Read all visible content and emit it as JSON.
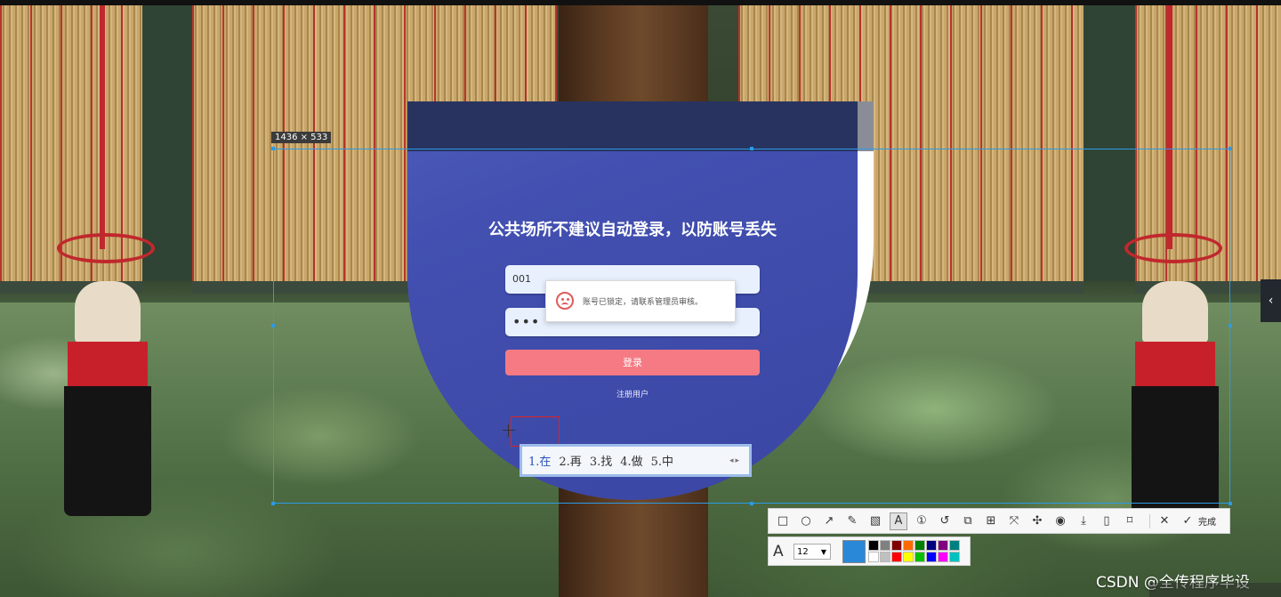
{
  "selection": {
    "size_label": "1436 × 533"
  },
  "login": {
    "title": "公共场所不建议自动登录，以防账号丢失",
    "username_value": "001",
    "password_value": "•••",
    "login_button": "登录",
    "register_link": "注册用户",
    "alert_message": "账号已锁定，请联系管理员审核。"
  },
  "ime": {
    "candidates": [
      "1.在",
      "2.再",
      "3.找",
      "4.做",
      "5.中"
    ],
    "page_arrows": "◂▸"
  },
  "side_tab": {
    "icon": "chevron-left-icon",
    "glyph": "‹"
  },
  "toolbar": {
    "tools": [
      {
        "name": "rectangle-icon",
        "glyph": "□"
      },
      {
        "name": "ellipse-icon",
        "glyph": "○"
      },
      {
        "name": "arrow-icon",
        "glyph": "↗"
      },
      {
        "name": "pencil-icon",
        "glyph": "✎"
      },
      {
        "name": "mosaic-icon",
        "glyph": "▧"
      },
      {
        "name": "text-icon",
        "glyph": "A"
      },
      {
        "name": "number-marker-icon",
        "glyph": "①"
      },
      {
        "name": "undo-icon",
        "glyph": "↺"
      },
      {
        "name": "ocr-icon",
        "glyph": "⧉"
      },
      {
        "name": "translate-icon",
        "glyph": "⊞"
      },
      {
        "name": "scroll-capture-icon",
        "glyph": "⤧"
      },
      {
        "name": "pin-icon",
        "glyph": "✣"
      },
      {
        "name": "record-icon",
        "glyph": "◉"
      },
      {
        "name": "download-icon",
        "glyph": "⤓"
      },
      {
        "name": "phone-icon",
        "glyph": "▯"
      },
      {
        "name": "bookmark-icon",
        "glyph": "⌑"
      }
    ],
    "close_glyph": "✕",
    "done_glyph": "✓",
    "done_label": "完成",
    "font_icon_glyph": "A",
    "font_size": "12",
    "dropdown_glyph": "▼",
    "current_color": "#2a88d8",
    "palette": [
      "#000000",
      "#808080",
      "#800000",
      "#ff6a00",
      "#008000",
      "#000080",
      "#800080",
      "#008080",
      "#ffffff",
      "#c0c0c0",
      "#ff0000",
      "#ffff00",
      "#00c000",
      "#0000ff",
      "#ff00ff",
      "#00c0c0"
    ]
  },
  "watermark": "CSDN @全传程序毕设"
}
